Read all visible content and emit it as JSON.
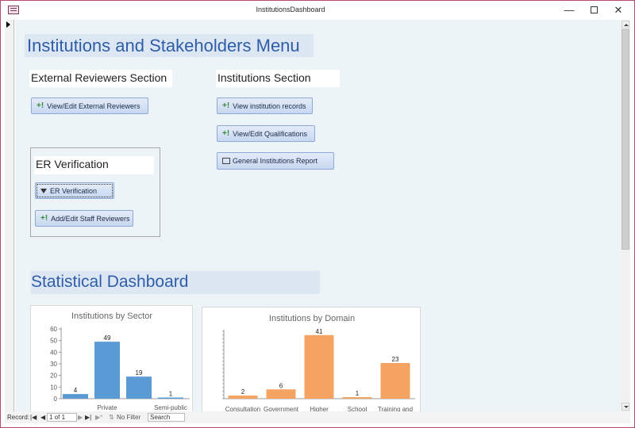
{
  "window": {
    "title": "InstitutionsDashboard"
  },
  "form": {
    "menu_title": "Institutions and Stakeholders Menu",
    "external_section_label": "External Reviewers Section",
    "institutions_section_label": "Institutions Section",
    "er_verification_label": "ER Verification",
    "dashboard_title": "Statistical Dashboard",
    "buttons": {
      "view_external_reviewers": "View/Edit External Reviewers",
      "view_institution_records": "View institution records",
      "view_qualifications": "View/Edit Qualifications",
      "general_report": "General Institutions Report",
      "er_verification": "ER Verification",
      "add_staff_reviewers": "Add/Edit Staff Reviewers"
    }
  },
  "status_bar": {
    "record_label": "Record:",
    "record_value": "1 of 1",
    "filter_label": "No Filter",
    "search_placeholder": "Search"
  },
  "colors": {
    "sector_bar": "#5b9bd5",
    "domain_bar": "#f4a460",
    "heading_text": "#2f5ea8",
    "heading_band": "#dde6f3"
  },
  "chart_data": [
    {
      "type": "bar",
      "title": "Institutions by Sector",
      "categories": [
        "",
        "Private",
        "",
        "Semi-public"
      ],
      "values": [
        4,
        49,
        19,
        1
      ],
      "ylim": [
        0,
        60
      ],
      "yticks": [
        0,
        10,
        20,
        30,
        40,
        50,
        60
      ],
      "color": "#5b9bd5"
    },
    {
      "type": "bar",
      "title": "Institutions by Domain",
      "categories": [
        "Consultation",
        "Government",
        "Higher",
        "School",
        "Training and"
      ],
      "values": [
        2,
        6,
        41,
        1,
        23
      ],
      "color": "#f4a460"
    }
  ]
}
